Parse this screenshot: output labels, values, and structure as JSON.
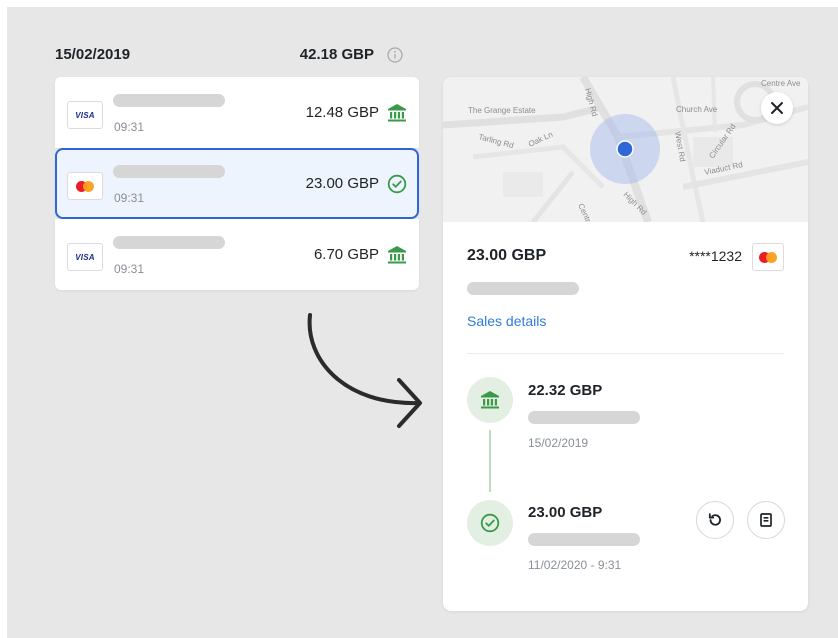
{
  "day": {
    "date": "15/02/2019",
    "total": "42.18 GBP"
  },
  "transactions": [
    {
      "card": "visa",
      "card_label": "VISA",
      "time": "09:31",
      "amount": "12.48 GBP",
      "status_icon": "bank-icon"
    },
    {
      "card": "mastercard",
      "time": "09:31",
      "amount": "23.00 GBP",
      "status_icon": "check-circle-icon",
      "selected": true
    },
    {
      "card": "visa",
      "card_label": "VISA",
      "time": "09:31",
      "amount": "6.70 GBP",
      "status_icon": "bank-icon"
    }
  ],
  "map": {
    "labels": [
      "The Grange Estate",
      "High Rd",
      "Centre Ave",
      "Church Ave",
      "West Rd",
      "Circular Rd",
      "Tarling Rd",
      "Oak Ln",
      "Viaduct Rd",
      "High Rd",
      "Centre"
    ]
  },
  "detail": {
    "amount": "23.00 GBP",
    "card_masked": "****1232",
    "sales_link": "Sales details",
    "timeline": [
      {
        "icon": "bank-icon",
        "amount": "22.32 GBP",
        "date": "15/02/2019"
      },
      {
        "icon": "check-circle-icon",
        "amount": "23.00 GBP",
        "date": "11/02/2020 - 9:31"
      }
    ]
  },
  "colors": {
    "accent_blue": "#2f67d6",
    "link_blue": "#2f7bdc",
    "success_green": "#3a9a4a",
    "skeleton": "#d6d6d6"
  }
}
